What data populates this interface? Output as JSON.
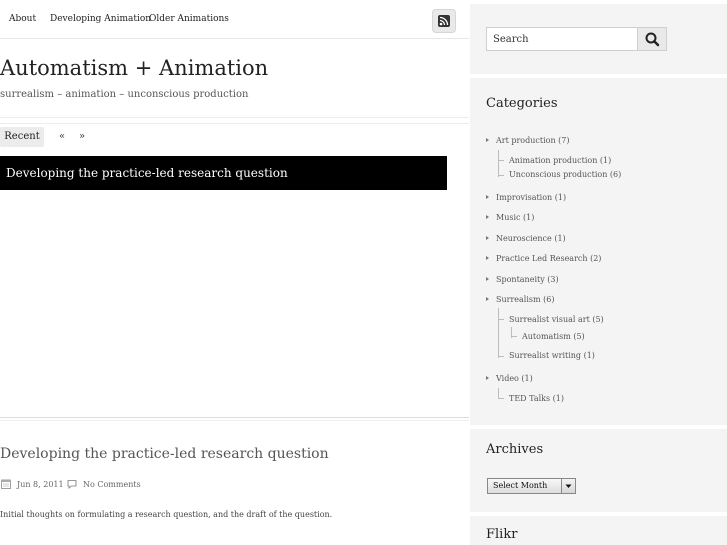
{
  "nav": {
    "items": [
      "About",
      "Developing Animation",
      "Older Animations"
    ],
    "rss_icon": "rss-icon"
  },
  "site": {
    "title": "Automatism + Animation",
    "description": "surrealism – animation – unconscious production"
  },
  "slider": {
    "recent_label": "Recent",
    "prev_label": "«",
    "next_label": "»",
    "caption": "Developing the practice-led research question"
  },
  "post": {
    "title": "Developing the practice-led research question",
    "date": "Jun 8, 2011",
    "comments": "No Comments",
    "excerpt": "Initial thoughts on formulating a research question, and the draft of the question.",
    "date_icon": "calendar-icon",
    "comment_icon": "comment-icon"
  },
  "search": {
    "placeholder": "Search",
    "icon": "search-icon"
  },
  "categories": {
    "title": "Categories",
    "items": [
      "Art production (7)",
      "Animation production (1)",
      "Unconscious production (6)",
      "Improvisation (1)",
      "Music (1)",
      "Neuroscience (1)",
      "Practice Led Research (2)",
      "Spontaneity (3)",
      "Surrealism (6)",
      "Surrealist visual art (5)",
      "Automatism (5)",
      "Surrealist writing (1)",
      "Video (1)",
      "TED Talks (1)"
    ]
  },
  "archives": {
    "title": "Archives",
    "select_value": "Select Month"
  },
  "flikr": {
    "title": "Flikr"
  },
  "colors": {
    "slider_bar": "#000000",
    "sidebar_bg": "#f4f4f4",
    "button_bg": "#ececec"
  }
}
